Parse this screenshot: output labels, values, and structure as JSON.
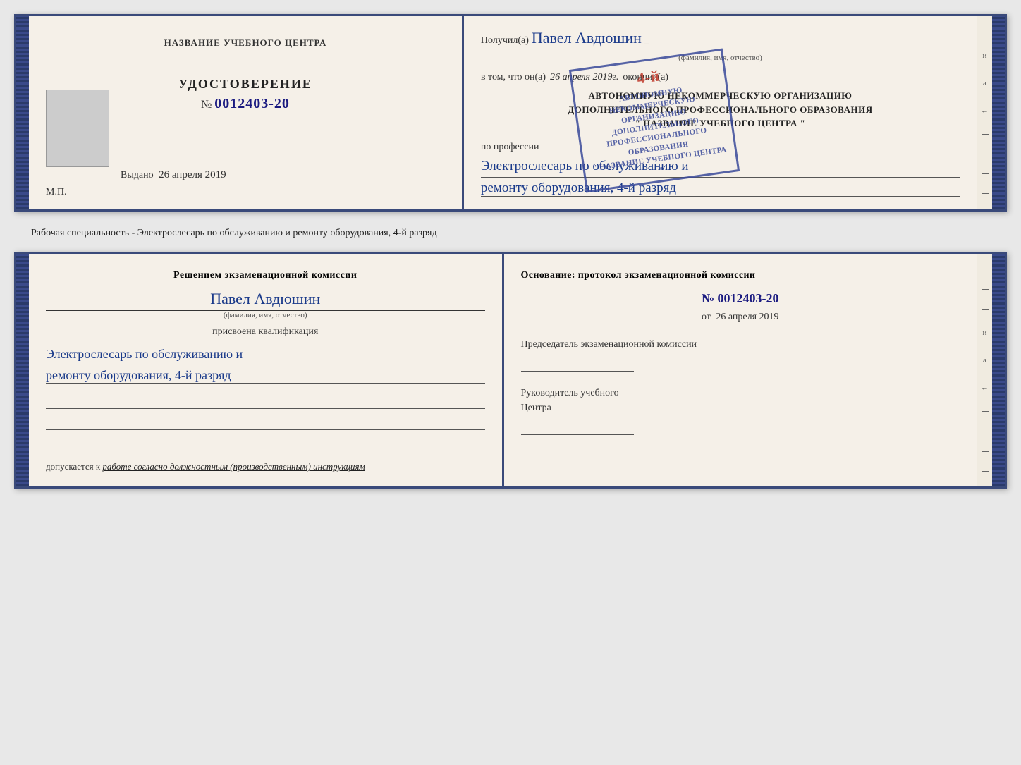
{
  "top_booklet": {
    "left": {
      "center_title": "НАЗВАНИЕ УЧЕБНОГО ЦЕНТРА",
      "cert_title": "УДОСТОВЕРЕНИЕ",
      "cert_number_label": "№",
      "cert_number": "0012403-20",
      "issued_label": "Выдано",
      "issued_date": "26 апреля 2019",
      "mp_label": "М.П."
    },
    "right": {
      "received_label": "Получил(а)",
      "recipient_name": "Павел Авдюшин",
      "fio_label": "(фамилия, имя, отчество)",
      "in_that_label": "в том, что он(а)",
      "completion_date": "26 апреля 2019г.",
      "finished_label": "окончил(а)",
      "org_line1": "АВТОНОМНУЮ НЕКОММЕРЧЕСКУЮ ОРГАНИЗАЦИЮ",
      "org_line2": "ДОПОЛНИТЕЛЬНОГО ПРОФЕССИОНАЛЬНОГО ОБРАЗОВАНИЯ",
      "org_name": "\" НАЗВАНИЕ УЧЕБНОГО ЦЕНТРА \"",
      "profession_label": "по профессии",
      "profession_line1": "Электрослесарь по обслуживанию и",
      "profession_line2": "ремонту оборудования, 4-й разряд"
    },
    "stamp": {
      "big_number": "4-й",
      "line1": "АВТОНОМНУЮ НЕКОММЕРЧЕСКУЮ ОРГАНИЗАЦИЮ",
      "line2": "ДОПОЛНИТЕЛЬНОГО ПРОФЕССИОНАЛЬНОГО ОБРАЗОВАНИЯ",
      "line3": "\" НАЗВАНИЕ УЧЕБНОГО ЦЕНТРА \""
    }
  },
  "description": {
    "text": "Рабочая специальность - Электрослесарь по обслуживанию и ремонту оборудования, 4-й разряд"
  },
  "bottom_booklet": {
    "left": {
      "decision_title": "Решением экзаменационной комиссии",
      "person_name": "Павел Авдюшин",
      "fio_label": "(фамилия, имя, отчество)",
      "assigned_label": "присвоена квалификация",
      "qualification_line1": "Электрослесарь по обслуживанию и",
      "qualification_line2": "ремонту оборудования, 4-й разряд",
      "permitted_label": "допускается к",
      "permitted_text": "работе согласно должностным (производственным) инструкциям"
    },
    "right": {
      "basis_label": "Основание: протокол экзаменационной комиссии",
      "protocol_number_label": "№",
      "protocol_number": "0012403-20",
      "date_prefix": "от",
      "protocol_date": "26 апреля 2019",
      "chairman_title": "Председатель экзаменационной комиссии",
      "director_title_line1": "Руководитель учебного",
      "director_title_line2": "Центра"
    }
  },
  "edge_marks": [
    "-",
    "и",
    "а",
    "←",
    "-",
    "-",
    "-",
    "-"
  ]
}
